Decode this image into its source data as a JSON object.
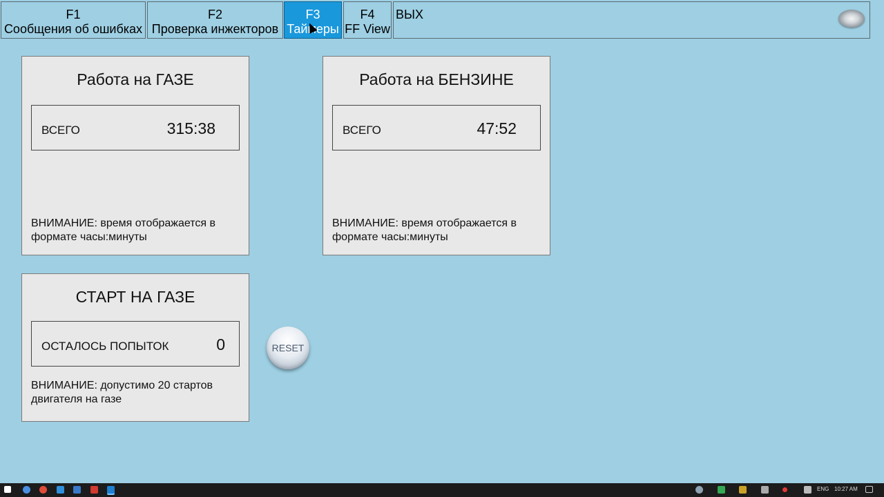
{
  "tabs": [
    {
      "key": "F1",
      "label": "Сообщения об ошибках",
      "active": false
    },
    {
      "key": "F2",
      "label": "Проверка инжекторов",
      "active": false
    },
    {
      "key": "F3",
      "label": "Таймеры",
      "active": true
    },
    {
      "key": "F4",
      "label": "FF View",
      "active": false
    },
    {
      "key": "ВЫХ",
      "label": "",
      "active": false
    }
  ],
  "panels": {
    "gas": {
      "title": "Работа на ГАЗЕ",
      "total_label": "ВСЕГО",
      "total_value": "315:38",
      "note": "ВНИМАНИЕ: время отображается в формате часы:минуты"
    },
    "petrol": {
      "title": "Работа на БЕНЗИНЕ",
      "total_label": "ВСЕГО",
      "total_value": "47:52",
      "note": "ВНИМАНИЕ: время отображается в формате часы:минуты"
    },
    "start": {
      "title": "СТАРТ НА ГАЗЕ",
      "attempts_label": "ОСТАЛОСЬ ПОПЫТОК",
      "attempts_value": "0",
      "note": "ВНИМАНИЕ: допустимо 20 стартов двигателя на газе"
    }
  },
  "reset_label": "RESET",
  "taskbar": {
    "language": "ENG",
    "time": "10:27 AM"
  },
  "colors": {
    "background": "#9ecfe3",
    "active_tab": "#1a98dc",
    "panel": "#e8e8e8"
  }
}
